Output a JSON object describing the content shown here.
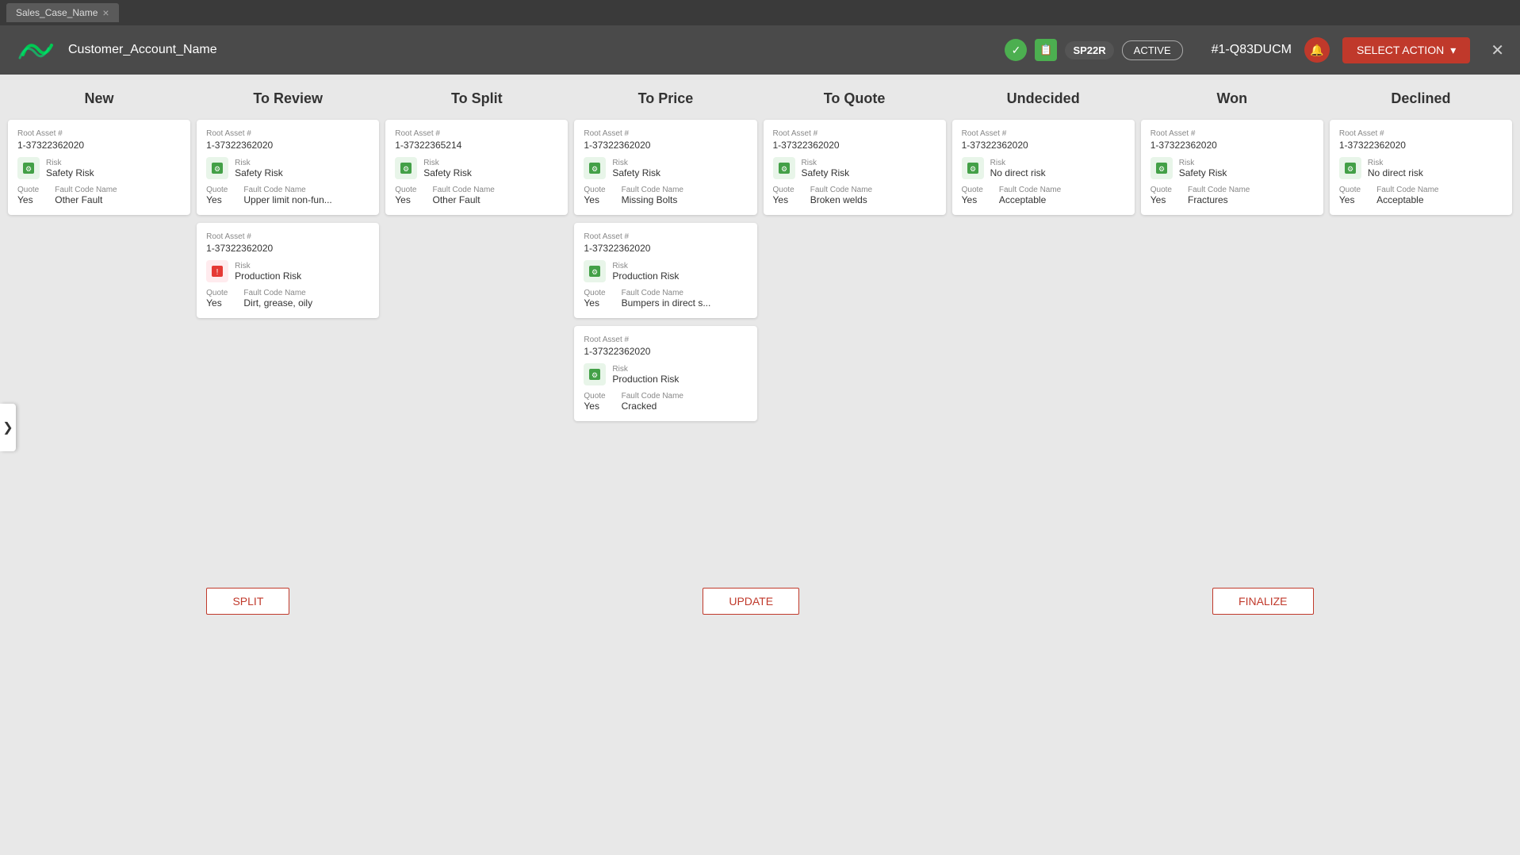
{
  "tab": {
    "label": "Sales_Case_Name",
    "close_label": "×"
  },
  "header": {
    "account_name": "Customer_Account_Name",
    "sp_badge": "SP22R",
    "active_badge": "ACTIVE",
    "case_id": "#1-Q83DUCM",
    "select_action_label": "SELECT ACTION"
  },
  "columns": [
    {
      "id": "new",
      "label": "New"
    },
    {
      "id": "to-review",
      "label": "To Review"
    },
    {
      "id": "to-split",
      "label": "To Split"
    },
    {
      "id": "to-price",
      "label": "To Price"
    },
    {
      "id": "to-quote",
      "label": "To Quote"
    },
    {
      "id": "undecided",
      "label": "Undecided"
    },
    {
      "id": "won",
      "label": "Won"
    },
    {
      "id": "declined",
      "label": "Declined"
    }
  ],
  "cards": {
    "new": [
      {
        "root_asset_label": "Root Asset #",
        "asset_id": "1-37322362020",
        "risk_label": "Risk",
        "risk_value": "Safety Risk",
        "risk_type": "green",
        "quote_label": "Quote",
        "quote_value": "Yes",
        "fault_label": "Fault Code Name",
        "fault_value": "Other Fault"
      }
    ],
    "to-review": [
      {
        "root_asset_label": "Root Asset #",
        "asset_id": "1-37322362020",
        "risk_label": "Risk",
        "risk_value": "Safety Risk",
        "risk_type": "green",
        "quote_label": "Quote",
        "quote_value": "Yes",
        "fault_label": "Fault Code Name",
        "fault_value": "Upper limit non-fun..."
      },
      {
        "root_asset_label": "Root Asset #",
        "asset_id": "1-37322362020",
        "risk_label": "Risk",
        "risk_value": "Production Risk",
        "risk_type": "red",
        "quote_label": "Quote",
        "quote_value": "Yes",
        "fault_label": "Fault Code Name",
        "fault_value": "Dirt, grease, oily"
      }
    ],
    "to-split": [
      {
        "root_asset_label": "Root Asset #",
        "asset_id": "1-37322365214",
        "risk_label": "Risk",
        "risk_value": "Safety Risk",
        "risk_type": "green",
        "quote_label": "Quote",
        "quote_value": "Yes",
        "fault_label": "Fault Code Name",
        "fault_value": "Other Fault"
      }
    ],
    "to-price": [
      {
        "root_asset_label": "Root Asset #",
        "asset_id": "1-37322362020",
        "risk_label": "Risk",
        "risk_value": "Safety Risk",
        "risk_type": "green",
        "quote_label": "Quote",
        "quote_value": "Yes",
        "fault_label": "Fault Code Name",
        "fault_value": "Missing Bolts"
      },
      {
        "root_asset_label": "Root Asset #",
        "asset_id": "1-37322362020",
        "risk_label": "Risk",
        "risk_value": "Production Risk",
        "risk_type": "green",
        "quote_label": "Quote",
        "quote_value": "Yes",
        "fault_label": "Fault Code Name",
        "fault_value": "Bumpers in direct s..."
      },
      {
        "root_asset_label": "Root Asset #",
        "asset_id": "1-37322362020",
        "risk_label": "Risk",
        "risk_value": "Production Risk",
        "risk_type": "green",
        "quote_label": "Quote",
        "quote_value": "Yes",
        "fault_label": "Fault Code Name",
        "fault_value": "Cracked"
      }
    ],
    "to-quote": [
      {
        "root_asset_label": "Root Asset #",
        "asset_id": "1-37322362020",
        "risk_label": "Risk",
        "risk_value": "Safety Risk",
        "risk_type": "green",
        "quote_label": "Quote",
        "quote_value": "Yes",
        "fault_label": "Fault Code Name",
        "fault_value": "Broken welds"
      }
    ],
    "undecided": [
      {
        "root_asset_label": "Root Asset #",
        "asset_id": "1-37322362020",
        "risk_label": "Risk",
        "risk_value": "No direct risk",
        "risk_type": "green",
        "quote_label": "Quote",
        "quote_value": "Yes",
        "fault_label": "Fault Code Name",
        "fault_value": "Acceptable"
      }
    ],
    "won": [
      {
        "root_asset_label": "Root Asset #",
        "asset_id": "1-37322362020",
        "risk_label": "Risk",
        "risk_value": "Safety Risk",
        "risk_type": "green",
        "quote_label": "Quote",
        "quote_value": "Yes",
        "fault_label": "Fault Code Name",
        "fault_value": "Fractures"
      }
    ],
    "declined": [
      {
        "root_asset_label": "Root Asset #",
        "asset_id": "1-37322362020",
        "risk_label": "Risk",
        "risk_value": "No direct risk",
        "risk_type": "green",
        "quote_label": "Quote",
        "quote_value": "Yes",
        "fault_label": "Fault Code Name",
        "fault_value": "Acceptable"
      }
    ]
  },
  "footer": {
    "split_label": "SPLIT",
    "update_label": "UPDATE",
    "finalize_label": "FINALIZE"
  },
  "sidebar_arrow": "❯"
}
